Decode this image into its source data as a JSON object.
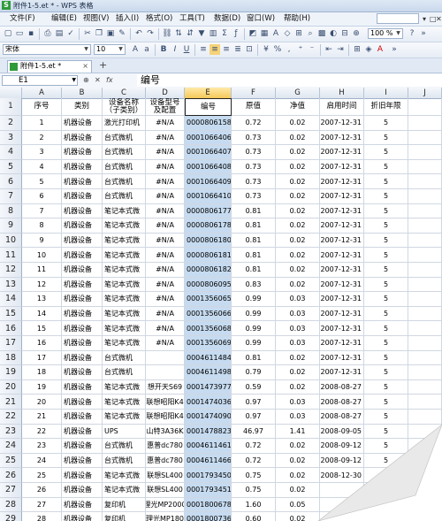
{
  "window": {
    "title": "附件1-5.et * - WPS 表格",
    "app_icon": "S"
  },
  "menubar": {
    "items": [
      "文件(F)",
      "编辑(E)",
      "视图(V)",
      "插入(I)",
      "格式(O)",
      "工具(T)",
      "数据(D)",
      "窗口(W)",
      "帮助(H)"
    ],
    "search_hint": "",
    "controls": [
      "▾",
      "□",
      "✕"
    ]
  },
  "toolbar1": {
    "zoom": "100 %"
  },
  "toolbar2": {
    "font_name": "宋体",
    "font_size": "10"
  },
  "tabs": {
    "active_label": "附件1-5.et *",
    "close": "×",
    "new_tab": "+"
  },
  "formula_bar": {
    "cell_ref": "E1",
    "fx": "fx",
    "content": "编号"
  },
  "columns": [
    "A",
    "B",
    "C",
    "D",
    "E",
    "F",
    "G",
    "H",
    "I",
    "J"
  ],
  "header_row": {
    "num": "1",
    "cells": [
      "序号",
      "类别",
      "设备名称（子类别）",
      "设备型号及配置",
      "编号",
      "原值",
      "净值",
      "启用时间",
      "折旧年限",
      ""
    ]
  },
  "rows": [
    {
      "num": "2",
      "cells": [
        "1",
        "机器设备",
        "激光打印机",
        "#N/A",
        "0000806158",
        "0.72",
        "0.02",
        "2007-12-31",
        "5",
        ""
      ]
    },
    {
      "num": "3",
      "cells": [
        "2",
        "机器设备",
        "台式微机",
        "#N/A",
        "0001066406",
        "0.73",
        "0.02",
        "2007-12-31",
        "5",
        ""
      ]
    },
    {
      "num": "4",
      "cells": [
        "3",
        "机器设备",
        "台式微机",
        "#N/A",
        "0001066407",
        "0.73",
        "0.02",
        "2007-12-31",
        "5",
        ""
      ]
    },
    {
      "num": "5",
      "cells": [
        "4",
        "机器设备",
        "台式微机",
        "#N/A",
        "0001066408",
        "0.73",
        "0.02",
        "2007-12-31",
        "5",
        ""
      ]
    },
    {
      "num": "6",
      "cells": [
        "5",
        "机器设备",
        "台式微机",
        "#N/A",
        "0001066409",
        "0.73",
        "0.02",
        "2007-12-31",
        "5",
        ""
      ]
    },
    {
      "num": "7",
      "cells": [
        "6",
        "机器设备",
        "台式微机",
        "#N/A",
        "0001066410",
        "0.73",
        "0.02",
        "2007-12-31",
        "5",
        ""
      ]
    },
    {
      "num": "8",
      "cells": [
        "7",
        "机器设备",
        "笔记本式微",
        "#N/A",
        "0000806177",
        "0.81",
        "0.02",
        "2007-12-31",
        "5",
        ""
      ]
    },
    {
      "num": "9",
      "cells": [
        "8",
        "机器设备",
        "笔记本式微",
        "#N/A",
        "0000806178",
        "0.81",
        "0.02",
        "2007-12-31",
        "5",
        ""
      ]
    },
    {
      "num": "10",
      "cells": [
        "9",
        "机器设备",
        "笔记本式微",
        "#N/A",
        "0000806180",
        "0.81",
        "0.02",
        "2007-12-31",
        "5",
        ""
      ]
    },
    {
      "num": "11",
      "cells": [
        "10",
        "机器设备",
        "笔记本式微",
        "#N/A",
        "0000806181",
        "0.81",
        "0.02",
        "2007-12-31",
        "5",
        ""
      ]
    },
    {
      "num": "12",
      "cells": [
        "11",
        "机器设备",
        "笔记本式微",
        "#N/A",
        "0000806182",
        "0.81",
        "0.02",
        "2007-12-31",
        "5",
        ""
      ]
    },
    {
      "num": "13",
      "cells": [
        "12",
        "机器设备",
        "笔记本式微",
        "#N/A",
        "0000806095",
        "0.83",
        "0.02",
        "2007-12-31",
        "5",
        ""
      ]
    },
    {
      "num": "14",
      "cells": [
        "13",
        "机器设备",
        "笔记本式微",
        "#N/A",
        "0001356065",
        "0.99",
        "0.03",
        "2007-12-31",
        "5",
        ""
      ]
    },
    {
      "num": "15",
      "cells": [
        "14",
        "机器设备",
        "笔记本式微",
        "#N/A",
        "0001356066",
        "0.99",
        "0.03",
        "2007-12-31",
        "5",
        ""
      ]
    },
    {
      "num": "16",
      "cells": [
        "15",
        "机器设备",
        "笔记本式微",
        "#N/A",
        "0001356068",
        "0.99",
        "0.03",
        "2007-12-31",
        "5",
        ""
      ]
    },
    {
      "num": "17",
      "cells": [
        "16",
        "机器设备",
        "笔记本式微",
        "#N/A",
        "0001356069",
        "0.99",
        "0.03",
        "2007-12-31",
        "5",
        ""
      ]
    },
    {
      "num": "18",
      "cells": [
        "17",
        "机器设备",
        "台式微机",
        "",
        "0004611484",
        "0.81",
        "0.02",
        "2007-12-31",
        "5",
        ""
      ]
    },
    {
      "num": "19",
      "cells": [
        "18",
        "机器设备",
        "台式微机",
        "",
        "0004611498",
        "0.79",
        "0.02",
        "2007-12-31",
        "5",
        ""
      ]
    },
    {
      "num": "20",
      "cells": [
        "19",
        "机器设备",
        "笔记本式微",
        "想开天S69",
        "0001473977",
        "0.59",
        "0.02",
        "2008-08-27",
        "5",
        ""
      ]
    },
    {
      "num": "21",
      "cells": [
        "20",
        "机器设备",
        "笔记本式微",
        "联想昭阳K4",
        "0001474036",
        "0.97",
        "0.03",
        "2008-08-27",
        "5",
        ""
      ]
    },
    {
      "num": "22",
      "cells": [
        "21",
        "机器设备",
        "笔记本式微",
        "联想昭阳K4",
        "0001474090",
        "0.97",
        "0.03",
        "2008-08-27",
        "5",
        ""
      ]
    },
    {
      "num": "23",
      "cells": [
        "22",
        "机器设备",
        "UPS",
        "山特3A36K",
        "0001478823",
        "46.97",
        "1.41",
        "2008-09-05",
        "5",
        ""
      ]
    },
    {
      "num": "24",
      "cells": [
        "23",
        "机器设备",
        "台式微机",
        "惠普dc780",
        "0004611461",
        "0.72",
        "0.02",
        "2008-09-12",
        "5",
        ""
      ]
    },
    {
      "num": "25",
      "cells": [
        "24",
        "机器设备",
        "台式微机",
        "惠普dc780",
        "0004611466",
        "0.72",
        "0.02",
        "2008-09-12",
        "5",
        ""
      ]
    },
    {
      "num": "26",
      "cells": [
        "25",
        "机器设备",
        "笔记本式微",
        "联想SL400",
        "0001793450",
        "0.75",
        "0.02",
        "2008-12-30",
        "5",
        ""
      ]
    },
    {
      "num": "27",
      "cells": [
        "26",
        "机器设备",
        "笔记本式微",
        "联想SL400",
        "0001793451",
        "0.75",
        "0.02",
        "",
        "",
        ""
      ]
    },
    {
      "num": "28",
      "cells": [
        "27",
        "机器设备",
        "复印机",
        "理光MP2000",
        "0001800678",
        "1.60",
        "0.05",
        "",
        "",
        ""
      ]
    },
    {
      "num": "29",
      "cells": [
        "28",
        "机器设备",
        "复印机",
        "理光MP180",
        "0001800736",
        "0.60",
        "0.02",
        "",
        "",
        ""
      ]
    }
  ],
  "colors": {
    "selection": "#c6dbf0",
    "header_highlight": "#f6c95a",
    "title_bg": "#c9d8ec"
  }
}
